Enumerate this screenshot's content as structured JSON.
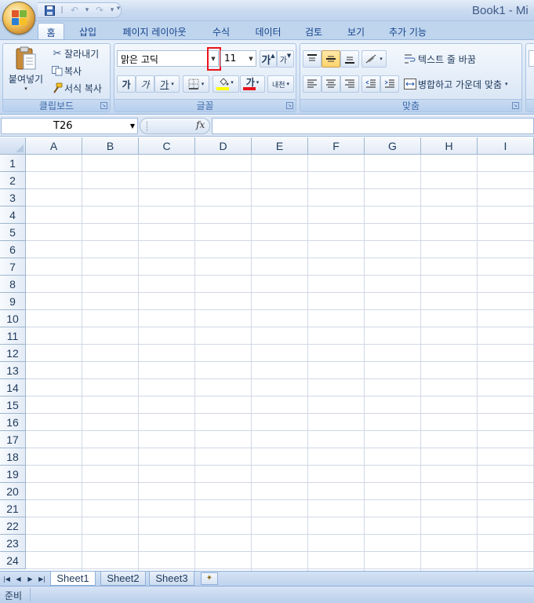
{
  "window": {
    "title": "Book1 - Mi"
  },
  "quick_access": {
    "save_icon": "save-icon",
    "undo_icon": "undo-icon",
    "redo_icon": "redo-icon"
  },
  "tabs": [
    {
      "label": "홈",
      "active": true
    },
    {
      "label": "삽입"
    },
    {
      "label": "페이지 레이아웃"
    },
    {
      "label": "수식"
    },
    {
      "label": "데이터"
    },
    {
      "label": "검토"
    },
    {
      "label": "보기"
    },
    {
      "label": "추가 기능"
    }
  ],
  "clipboard": {
    "group_label": "클립보드",
    "paste_label": "붙여넣기",
    "cut_label": "잘라내기",
    "copy_label": "복사",
    "format_painter_label": "서식 복사"
  },
  "font": {
    "group_label": "글꼴",
    "font_name": "맑은 고딕",
    "font_size": "11",
    "grow_label": "가",
    "shrink_label": "가",
    "bold_label": "가",
    "italic_label": "가",
    "underline_label": "가",
    "font_color_label": "가",
    "phonetic_label": "내천"
  },
  "alignment": {
    "group_label": "맞춤",
    "wrap_text_label": "텍스트 줄 바꿈",
    "merge_center_label": "병합하고 가운데 맞춤"
  },
  "formula_bar": {
    "name_box": "T26",
    "fx_label": "fx",
    "formula": ""
  },
  "columns": [
    "A",
    "B",
    "C",
    "D",
    "E",
    "F",
    "G",
    "H",
    "I"
  ],
  "rows": [
    "1",
    "2",
    "3",
    "4",
    "5",
    "6",
    "7",
    "8",
    "9",
    "10",
    "11",
    "12",
    "13",
    "14",
    "15",
    "16",
    "17",
    "18",
    "19",
    "20",
    "21",
    "22",
    "23",
    "24"
  ],
  "sheets": [
    {
      "label": "Sheet1",
      "active": true
    },
    {
      "label": "Sheet2"
    },
    {
      "label": "Sheet3"
    }
  ],
  "status": {
    "text": "준비"
  },
  "colors": {
    "highlight": "#e8141c",
    "fill_swatch": "#ffff00",
    "font_color_swatch": "#e8141c"
  }
}
